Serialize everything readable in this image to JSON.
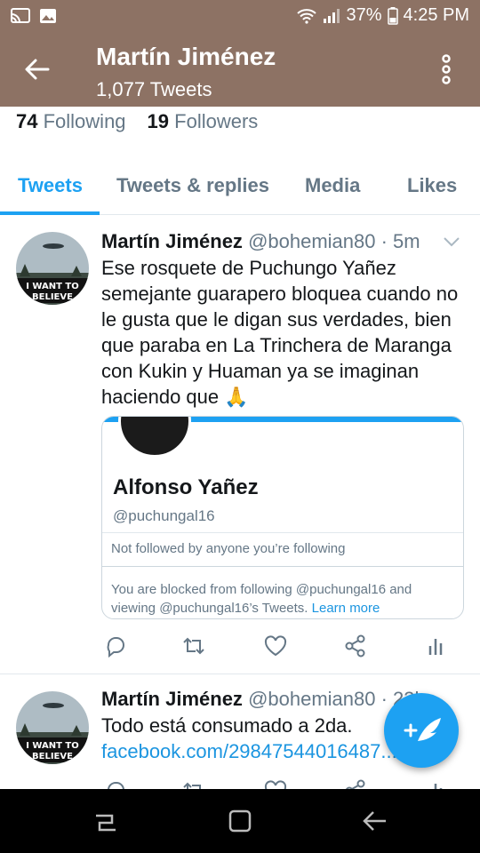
{
  "status_bar": {
    "battery": "37%",
    "time": "4:25 PM",
    "icons": [
      "cast-icon",
      "image-icon",
      "wifi-icon",
      "signal-icon",
      "battery-icon"
    ]
  },
  "header": {
    "name": "Martín Jiménez",
    "tweet_count": "1,077 Tweets"
  },
  "profile": {
    "following_count": "74",
    "following_label": "Following",
    "followers_count": "19",
    "followers_label": "Followers"
  },
  "tabs": [
    {
      "label": "Tweets",
      "active": true
    },
    {
      "label": "Tweets & replies",
      "active": false
    },
    {
      "label": "Media",
      "active": false
    },
    {
      "label": "Likes",
      "active": false
    }
  ],
  "tweets": [
    {
      "author": "Martín Jiménez",
      "handle": "@bohemian80 · 5m",
      "avatar_text": "I WANT TO BELIEVE",
      "text": "Ese rosquete de Puchungo Yañez semejante guarapero bloquea cuando no le gusta que le digan sus verdades, bien que paraba en La Trinchera de Maranga con Kukin y Huaman ya se imaginan haciendo que 🙏",
      "card": {
        "name": "Alfonso Yañez",
        "handle": "@puchungal16",
        "note": "Not followed by anyone you’re following",
        "blocked_text": "You are blocked from following @puchungal16 and viewing @puchungal16’s Tweets.",
        "learn_more": "Learn more"
      }
    },
    {
      "author": "Martín Jiménez",
      "handle": "@bohemian80 · 23h",
      "avatar_text": "I WANT TO BELIEVE",
      "text": "Todo está consumado a 2da.",
      "link": "facebook.com/29847544016487..."
    }
  ],
  "colors": {
    "header_bg": "#8d7264",
    "accent": "#1da1f2",
    "text": "#14171a",
    "muted": "#657786"
  }
}
